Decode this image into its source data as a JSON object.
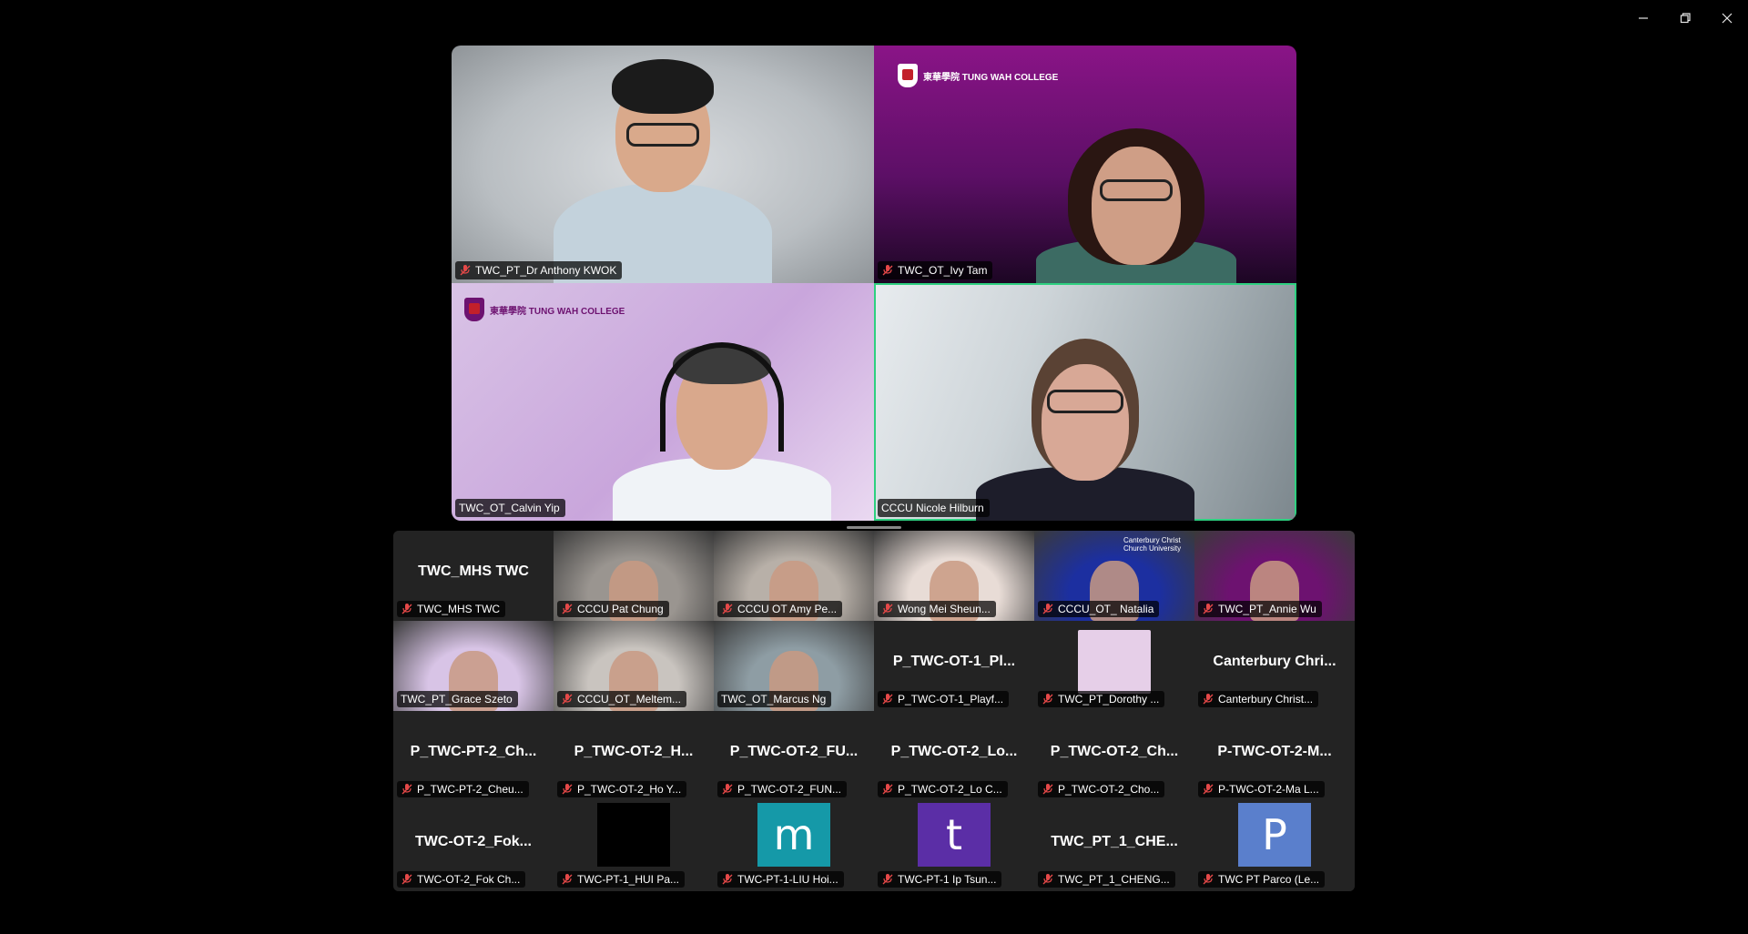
{
  "window_controls": {
    "minimize": "minimize",
    "restore": "restore",
    "close": "close"
  },
  "speakers": [
    {
      "name": "TWC_PT_Dr Anthony KWOK",
      "bg": "grey",
      "muted": true
    },
    {
      "name": "TWC_OT_Ivy Tam",
      "bg": "purple",
      "muted": true,
      "logo_text": "東華學院 TUNG WAH COLLEGE"
    },
    {
      "name": "TWC_OT_Calvin Yip",
      "bg": "lilac",
      "muted": false,
      "logo_text": "東華學院 TUNG WAH COLLEGE"
    },
    {
      "name": "CCCU Nicole Hilburn",
      "bg": "room",
      "muted": false,
      "active": true
    }
  ],
  "gallery": [
    {
      "display": "TWC_MHS TWC",
      "name": "TWC_MHS TWC",
      "muted": true,
      "type": "text"
    },
    {
      "name": "CCCU Pat Chung",
      "muted": true,
      "type": "video",
      "tint": "#9a9590"
    },
    {
      "name": "CCCU OT Amy Pe...",
      "muted": true,
      "type": "video",
      "tint": "#b8b0a8"
    },
    {
      "name": "Wong Mei Sheun...",
      "muted": true,
      "type": "video",
      "tint": "#e8dcd6"
    },
    {
      "name": "CCCU_OT_ Natalia",
      "muted": true,
      "type": "video",
      "tint": "#1c2fa0",
      "logo_text": "Canterbury Christ Church University"
    },
    {
      "name": "TWC_PT_Annie Wu",
      "muted": true,
      "type": "video",
      "tint": "#6d1270"
    },
    {
      "name": "TWC_PT_Grace Szeto",
      "muted": false,
      "type": "video",
      "tint": "#d8c4e6"
    },
    {
      "name": "CCCU_OT_Meltem...",
      "muted": true,
      "type": "video",
      "tint": "#c9c4bf"
    },
    {
      "name": "TWC_OT_Marcus Ng",
      "muted": false,
      "type": "video",
      "tint": "#8e9da4"
    },
    {
      "display": "P_TWC-OT-1_Pl...",
      "name": "P_TWC-OT-1_Playf...",
      "muted": true,
      "type": "text"
    },
    {
      "name": "TWC_PT_Dorothy ...",
      "muted": true,
      "type": "slide",
      "tint": "#e6cfe8"
    },
    {
      "display": "Canterbury  Chri...",
      "name": "Canterbury Christ...",
      "muted": true,
      "type": "text"
    },
    {
      "display": "P_TWC-PT-2_Ch...",
      "name": "P_TWC-PT-2_Cheu...",
      "muted": true,
      "type": "text"
    },
    {
      "display": "P_TWC-OT-2_H...",
      "name": "P_TWC-OT-2_Ho Y...",
      "muted": true,
      "type": "text"
    },
    {
      "display": "P_TWC-OT-2_FU...",
      "name": "P_TWC-OT-2_FUN...",
      "muted": true,
      "type": "text"
    },
    {
      "display": "P_TWC-OT-2_Lo...",
      "name": "P_TWC-OT-2_Lo C...",
      "muted": true,
      "type": "text"
    },
    {
      "display": "P_TWC-OT-2_Ch...",
      "name": "P_TWC-OT-2_Cho...",
      "muted": true,
      "type": "text"
    },
    {
      "display": "P-TWC-OT-2-M...",
      "name": "P-TWC-OT-2-Ma L...",
      "muted": true,
      "type": "text"
    },
    {
      "display": "TWC-OT-2_Fok...",
      "name": "TWC-OT-2_Fok Ch...",
      "muted": true,
      "type": "text"
    },
    {
      "name": "TWC-PT-1_HUI Pa...",
      "muted": true,
      "type": "avatar",
      "avatar_letter": "",
      "avatar_color": "#000000"
    },
    {
      "name": "TWC-PT-1-LIU Hoi...",
      "muted": true,
      "type": "avatar",
      "avatar_letter": "m",
      "avatar_color": "#1599a8"
    },
    {
      "name": "TWC-PT-1 Ip Tsun...",
      "muted": true,
      "type": "avatar",
      "avatar_letter": "t",
      "avatar_color": "#5b2ea6"
    },
    {
      "display": "TWC_PT_1_CHE...",
      "name": "TWC_PT_1_CHENG...",
      "muted": true,
      "type": "text"
    },
    {
      "name": "TWC PT Parco (Le...",
      "muted": true,
      "type": "avatar",
      "avatar_letter": "P",
      "avatar_color": "#5a7fcc"
    }
  ]
}
